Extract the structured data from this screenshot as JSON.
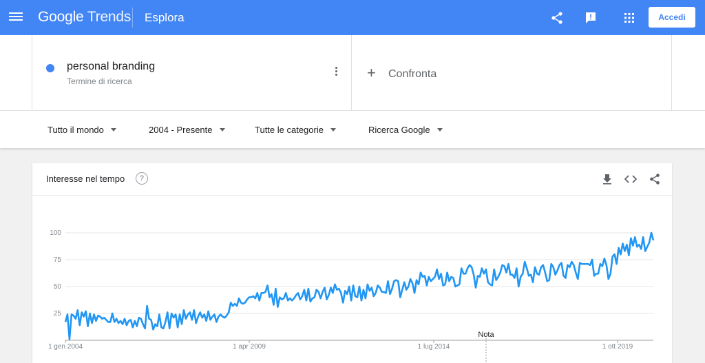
{
  "header": {
    "logo_google": "Google",
    "logo_trends": "Trends",
    "section": "Esplora",
    "login_label": "Accedi",
    "icons": [
      "menu-icon",
      "share-icon",
      "feedback-icon",
      "apps-icon"
    ],
    "bar_color": "#4285f4"
  },
  "search_term": {
    "name": "personal branding",
    "type": "Termine di ricerca",
    "color": "#4285f4"
  },
  "compare": {
    "label": "Confronta"
  },
  "filters": [
    {
      "label": "Tutto il mondo"
    },
    {
      "label": "2004 - Presente"
    },
    {
      "label": "Tutte le categorie"
    },
    {
      "label": "Ricerca Google"
    }
  ],
  "interest_card": {
    "title": "Interesse nel tempo",
    "help": "?",
    "actions": [
      "download-icon",
      "embed-icon",
      "share-icon"
    ]
  },
  "chart_data": {
    "type": "line",
    "series": [
      {
        "color": "#2196f3",
        "values": [
          17,
          24,
          1,
          24,
          23,
          20,
          28,
          14,
          26,
          22,
          27,
          13,
          25,
          16,
          24,
          18,
          23,
          22,
          20,
          21,
          19,
          17,
          17,
          25,
          17,
          20,
          16,
          18,
          15,
          20,
          14,
          18,
          19,
          12,
          18,
          13,
          21,
          20,
          15,
          11,
          32,
          20,
          19,
          10,
          15,
          13,
          24,
          12,
          11,
          17,
          26,
          11,
          25,
          21,
          24,
          12,
          24,
          15,
          28,
          20,
          24,
          26,
          19,
          28,
          16,
          22,
          26,
          21,
          24,
          18,
          27,
          19,
          22,
          24,
          17,
          22,
          24,
          22,
          21,
          23,
          26,
          35,
          32,
          34,
          32,
          39,
          35,
          34,
          35,
          38,
          40,
          40,
          41,
          39,
          44,
          37,
          44,
          44,
          45,
          51,
          40,
          43,
          33,
          48,
          31,
          40,
          38,
          39,
          44,
          37,
          39,
          37,
          39,
          42,
          44,
          38,
          41,
          47,
          37,
          48,
          36,
          39,
          40,
          47,
          45,
          39,
          45,
          49,
          38,
          42,
          49,
          44,
          52,
          47,
          48,
          44,
          35,
          46,
          43,
          50,
          37,
          51,
          41,
          40,
          50,
          37,
          47,
          39,
          52,
          46,
          49,
          41,
          44,
          51,
          49,
          45,
          45,
          44,
          55,
          43,
          48,
          55,
          56,
          55,
          40,
          47,
          54,
          47,
          50,
          57,
          53,
          44,
          56,
          52,
          63,
          59,
          60,
          51,
          59,
          55,
          57,
          59,
          66,
          57,
          62,
          51,
          52,
          63,
          55,
          59,
          58,
          50,
          51,
          52,
          67,
          62,
          62,
          67,
          70,
          68,
          61,
          49,
          60,
          59,
          67,
          62,
          66,
          54,
          52,
          51,
          66,
          56,
          59,
          63,
          70,
          69,
          63,
          71,
          61,
          61,
          58,
          67,
          50,
          59,
          62,
          73,
          67,
          60,
          61,
          54,
          68,
          62,
          61,
          68,
          70,
          63,
          55,
          56,
          71,
          68,
          61,
          65,
          70,
          72,
          60,
          58,
          70,
          68,
          73,
          70,
          63,
          57,
          72,
          71,
          71,
          71,
          71,
          70,
          75,
          60,
          62,
          62,
          71,
          69,
          76,
          70,
          57,
          62,
          78,
          80,
          71,
          86,
          80,
          90,
          83,
          89,
          79,
          95,
          88,
          96,
          87,
          89,
          85,
          96,
          83,
          87,
          91,
          100,
          93
        ]
      }
    ],
    "ylim": [
      0,
      100
    ],
    "yticks": [
      "25",
      "50",
      "75",
      "100"
    ],
    "xtick_labels": [
      "1 gen 2004",
      "1 apr 2009",
      "1 lug 2014",
      "1 ott 2019"
    ],
    "annotation": "Nota",
    "grid": true
  }
}
